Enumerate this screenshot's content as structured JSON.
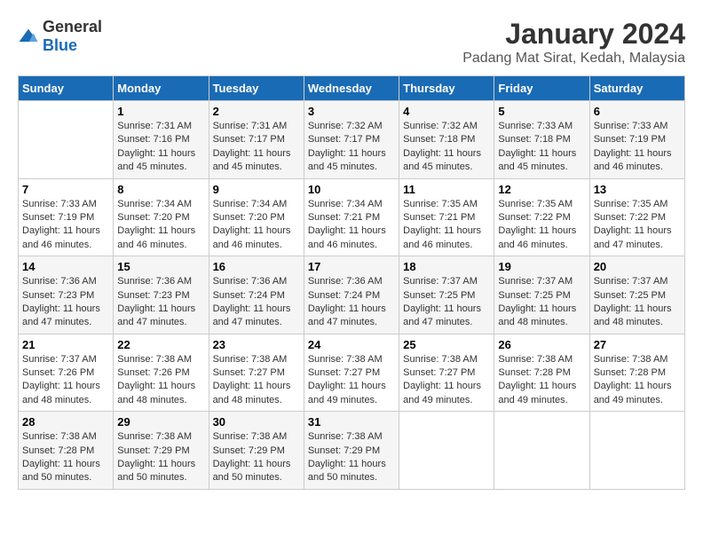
{
  "header": {
    "logo": {
      "general": "General",
      "blue": "Blue"
    },
    "title": "January 2024",
    "subtitle": "Padang Mat Sirat, Kedah, Malaysia"
  },
  "calendar": {
    "days_of_week": [
      "Sunday",
      "Monday",
      "Tuesday",
      "Wednesday",
      "Thursday",
      "Friday",
      "Saturday"
    ],
    "weeks": [
      [
        {
          "day": "",
          "info": ""
        },
        {
          "day": "1",
          "info": "Sunrise: 7:31 AM\nSunset: 7:16 PM\nDaylight: 11 hours\nand 45 minutes."
        },
        {
          "day": "2",
          "info": "Sunrise: 7:31 AM\nSunset: 7:17 PM\nDaylight: 11 hours\nand 45 minutes."
        },
        {
          "day": "3",
          "info": "Sunrise: 7:32 AM\nSunset: 7:17 PM\nDaylight: 11 hours\nand 45 minutes."
        },
        {
          "day": "4",
          "info": "Sunrise: 7:32 AM\nSunset: 7:18 PM\nDaylight: 11 hours\nand 45 minutes."
        },
        {
          "day": "5",
          "info": "Sunrise: 7:33 AM\nSunset: 7:18 PM\nDaylight: 11 hours\nand 45 minutes."
        },
        {
          "day": "6",
          "info": "Sunrise: 7:33 AM\nSunset: 7:19 PM\nDaylight: 11 hours\nand 46 minutes."
        }
      ],
      [
        {
          "day": "7",
          "info": "Sunrise: 7:33 AM\nSunset: 7:19 PM\nDaylight: 11 hours\nand 46 minutes."
        },
        {
          "day": "8",
          "info": "Sunrise: 7:34 AM\nSunset: 7:20 PM\nDaylight: 11 hours\nand 46 minutes."
        },
        {
          "day": "9",
          "info": "Sunrise: 7:34 AM\nSunset: 7:20 PM\nDaylight: 11 hours\nand 46 minutes."
        },
        {
          "day": "10",
          "info": "Sunrise: 7:34 AM\nSunset: 7:21 PM\nDaylight: 11 hours\nand 46 minutes."
        },
        {
          "day": "11",
          "info": "Sunrise: 7:35 AM\nSunset: 7:21 PM\nDaylight: 11 hours\nand 46 minutes."
        },
        {
          "day": "12",
          "info": "Sunrise: 7:35 AM\nSunset: 7:22 PM\nDaylight: 11 hours\nand 46 minutes."
        },
        {
          "day": "13",
          "info": "Sunrise: 7:35 AM\nSunset: 7:22 PM\nDaylight: 11 hours\nand 47 minutes."
        }
      ],
      [
        {
          "day": "14",
          "info": "Sunrise: 7:36 AM\nSunset: 7:23 PM\nDaylight: 11 hours\nand 47 minutes."
        },
        {
          "day": "15",
          "info": "Sunrise: 7:36 AM\nSunset: 7:23 PM\nDaylight: 11 hours\nand 47 minutes."
        },
        {
          "day": "16",
          "info": "Sunrise: 7:36 AM\nSunset: 7:24 PM\nDaylight: 11 hours\nand 47 minutes."
        },
        {
          "day": "17",
          "info": "Sunrise: 7:36 AM\nSunset: 7:24 PM\nDaylight: 11 hours\nand 47 minutes."
        },
        {
          "day": "18",
          "info": "Sunrise: 7:37 AM\nSunset: 7:25 PM\nDaylight: 11 hours\nand 47 minutes."
        },
        {
          "day": "19",
          "info": "Sunrise: 7:37 AM\nSunset: 7:25 PM\nDaylight: 11 hours\nand 48 minutes."
        },
        {
          "day": "20",
          "info": "Sunrise: 7:37 AM\nSunset: 7:25 PM\nDaylight: 11 hours\nand 48 minutes."
        }
      ],
      [
        {
          "day": "21",
          "info": "Sunrise: 7:37 AM\nSunset: 7:26 PM\nDaylight: 11 hours\nand 48 minutes."
        },
        {
          "day": "22",
          "info": "Sunrise: 7:38 AM\nSunset: 7:26 PM\nDaylight: 11 hours\nand 48 minutes."
        },
        {
          "day": "23",
          "info": "Sunrise: 7:38 AM\nSunset: 7:27 PM\nDaylight: 11 hours\nand 48 minutes."
        },
        {
          "day": "24",
          "info": "Sunrise: 7:38 AM\nSunset: 7:27 PM\nDaylight: 11 hours\nand 49 minutes."
        },
        {
          "day": "25",
          "info": "Sunrise: 7:38 AM\nSunset: 7:27 PM\nDaylight: 11 hours\nand 49 minutes."
        },
        {
          "day": "26",
          "info": "Sunrise: 7:38 AM\nSunset: 7:28 PM\nDaylight: 11 hours\nand 49 minutes."
        },
        {
          "day": "27",
          "info": "Sunrise: 7:38 AM\nSunset: 7:28 PM\nDaylight: 11 hours\nand 49 minutes."
        }
      ],
      [
        {
          "day": "28",
          "info": "Sunrise: 7:38 AM\nSunset: 7:28 PM\nDaylight: 11 hours\nand 50 minutes."
        },
        {
          "day": "29",
          "info": "Sunrise: 7:38 AM\nSunset: 7:29 PM\nDaylight: 11 hours\nand 50 minutes."
        },
        {
          "day": "30",
          "info": "Sunrise: 7:38 AM\nSunset: 7:29 PM\nDaylight: 11 hours\nand 50 minutes."
        },
        {
          "day": "31",
          "info": "Sunrise: 7:38 AM\nSunset: 7:29 PM\nDaylight: 11 hours\nand 50 minutes."
        },
        {
          "day": "",
          "info": ""
        },
        {
          "day": "",
          "info": ""
        },
        {
          "day": "",
          "info": ""
        }
      ]
    ]
  }
}
